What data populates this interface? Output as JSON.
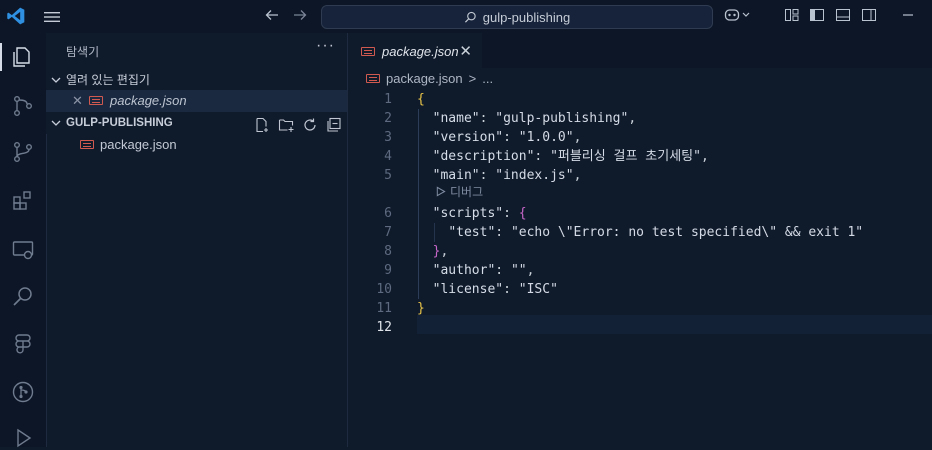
{
  "titlebar": {
    "search_text": "gulp-publishing"
  },
  "sidebar": {
    "title": "탐색기",
    "more": "···",
    "open_editors_label": "열려 있는 편집기",
    "open_file": "package.json",
    "folder_label": "GULP-PUBLISHING",
    "tree_file": "package.json"
  },
  "editor": {
    "tab_label": "package.json",
    "breadcrumb_file": "package.json",
    "breadcrumb_sep": ">",
    "breadcrumb_more": "...",
    "codelens": "디버그",
    "line_numbers": [
      "1",
      "2",
      "3",
      "4",
      "5",
      "6",
      "7",
      "8",
      "9",
      "10",
      "11",
      "12"
    ],
    "lines": {
      "l1_open": "{",
      "name_key": "\"name\"",
      "name_val": "\"gulp-publishing\"",
      "version_key": "\"version\"",
      "version_val": "\"1.0.0\"",
      "desc_key": "\"description\"",
      "desc_val": "\"퍼블리싱 걸프 초기세팅\"",
      "main_key": "\"main\"",
      "main_val": "\"index.js\"",
      "scripts_key": "\"scripts\"",
      "scripts_open": "{",
      "test_key": "\"test\"",
      "test_val": "\"echo \\\"Error: no test specified\\\" && exit 1\"",
      "scripts_close": "}",
      "author_key": "\"author\"",
      "author_val": "\"\"",
      "license_key": "\"license\"",
      "license_val": "\"ISC\"",
      "l11_close": "}"
    }
  },
  "colors": {
    "background": "#0f1a2b",
    "json_icon": "#d15a50",
    "brace_outer": "#e8c548",
    "brace_inner": "#c767c8"
  }
}
